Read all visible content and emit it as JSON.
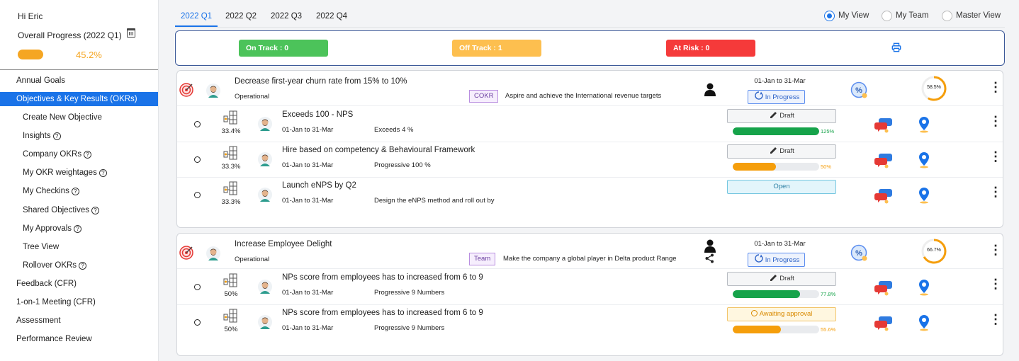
{
  "sidebar": {
    "greeting": "Hi Eric",
    "overall_label": "Overall Progress (2022 Q1)",
    "overall_percent": 45.2,
    "overall_percent_text": "45.2%",
    "nav": [
      {
        "label": "Annual Goals",
        "level": 1,
        "active": false,
        "help": false
      },
      {
        "label": "Objectives & Key Results (OKRs)",
        "level": 1,
        "active": true,
        "help": false
      },
      {
        "label": "Create New Objective",
        "level": 2,
        "active": false,
        "help": false
      },
      {
        "label": "Insights",
        "level": 2,
        "active": false,
        "help": true
      },
      {
        "label": "Company OKRs",
        "level": 2,
        "active": false,
        "help": true
      },
      {
        "label": "My OKR weightages",
        "level": 2,
        "active": false,
        "help": true
      },
      {
        "label": "My Checkins",
        "level": 2,
        "active": false,
        "help": true
      },
      {
        "label": "Shared Objectives",
        "level": 2,
        "active": false,
        "help": true
      },
      {
        "label": "My Approvals",
        "level": 2,
        "active": false,
        "help": true
      },
      {
        "label": "Tree View",
        "level": 2,
        "active": false,
        "help": false
      },
      {
        "label": "Rollover OKRs",
        "level": 2,
        "active": false,
        "help": true
      },
      {
        "label": "Feedback (CFR)",
        "level": 1,
        "active": false,
        "help": false
      },
      {
        "label": "1-on-1 Meeting (CFR)",
        "level": 1,
        "active": false,
        "help": false
      },
      {
        "label": "Assessment",
        "level": 1,
        "active": false,
        "help": false
      },
      {
        "label": "Performance Review",
        "level": 1,
        "active": false,
        "help": false
      }
    ]
  },
  "tabs": [
    {
      "label": "2022 Q1",
      "active": true
    },
    {
      "label": "2022 Q2",
      "active": false
    },
    {
      "label": "2022 Q3",
      "active": false
    },
    {
      "label": "2022 Q4",
      "active": false
    }
  ],
  "views": [
    {
      "label": "My View",
      "selected": true
    },
    {
      "label": "My Team",
      "selected": false
    },
    {
      "label": "Master View",
      "selected": false
    }
  ],
  "status": {
    "on_track": "On Track : 0",
    "off_track": "Off Track : 1",
    "at_risk": "At Risk : 0",
    "colors": {
      "on_track": "#4cc35a",
      "off_track": "#fdbf4f",
      "at_risk": "#f53a3a"
    }
  },
  "objectives": [
    {
      "title": "Decrease first-year churn rate from 15% to 10%",
      "type": "Operational",
      "tag": "COKR",
      "aligned_to": "Aspire and achieve the International revenue targets",
      "dates": "01-Jan to 31-Mar",
      "status": "In Progress",
      "progress": 58.5,
      "progress_text": "58.5%",
      "shared": false,
      "key_results": [
        {
          "title": "Exceeds 100 - NPS",
          "weight": "33.4%",
          "dates": "01-Jan to 31-Mar",
          "target": "Exceeds 4 %",
          "state": "Draft",
          "progress": 125,
          "progress_text": "125%",
          "bar_color": "#16a34a"
        },
        {
          "title": "Hire based on competency & Behavioural Framework",
          "weight": "33.3%",
          "dates": "01-Jan to 31-Mar",
          "target": "Progressive 100 %",
          "state": "Draft",
          "progress": 50,
          "progress_text": "50%",
          "bar_color": "#f59e0b"
        },
        {
          "title": "Launch eNPS by Q2",
          "weight": "33.3%",
          "dates": "01-Jan to 31-Mar",
          "target": "Design the eNPS method and roll out by",
          "state": "Open",
          "progress": null,
          "progress_text": "",
          "bar_color": ""
        }
      ]
    },
    {
      "title": "Increase Employee Delight",
      "type": "Operational",
      "tag": "Team",
      "aligned_to": "Make the company a global player in Delta product Range",
      "dates": "01-Jan to 31-Mar",
      "status": "In Progress",
      "progress": 66.7,
      "progress_text": "66.7%",
      "shared": true,
      "key_results": [
        {
          "title": "NPs score from employees has to increased from 6 to 9",
          "weight": "50%",
          "dates": "01-Jan to 31-Mar",
          "target": "Progressive 9 Numbers",
          "state": "Draft",
          "progress": 77.8,
          "progress_text": "77.8%",
          "bar_color": "#16a34a"
        },
        {
          "title": "NPs score from employees has to increased from 6 to 9",
          "weight": "50%",
          "dates": "01-Jan to 31-Mar",
          "target": "Progressive 9 Numbers",
          "state": "Awaiting approval",
          "progress": 55.6,
          "progress_text": "55.6%",
          "bar_color": "#f59e0b"
        }
      ]
    }
  ]
}
